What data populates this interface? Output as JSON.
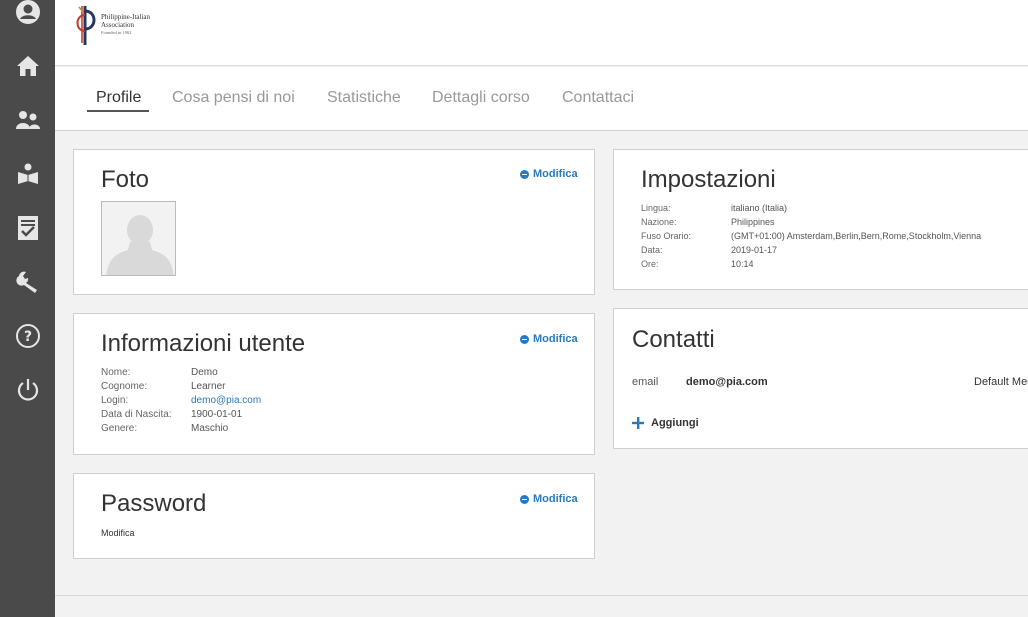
{
  "logo": {
    "line1": "Philippine-Italian",
    "line2": "Association",
    "line3": "Founded in 1962"
  },
  "sidebar": {
    "items": [
      {
        "name": "user-icon"
      },
      {
        "name": "home-icon"
      },
      {
        "name": "users-icon"
      },
      {
        "name": "reader-icon"
      },
      {
        "name": "checklist-icon"
      },
      {
        "name": "wrench-icon"
      },
      {
        "name": "help-icon"
      },
      {
        "name": "power-icon"
      }
    ]
  },
  "tabs": [
    {
      "label": "Profile",
      "active": true
    },
    {
      "label": "Cosa pensi di noi",
      "active": false
    },
    {
      "label": "Statistiche",
      "active": false
    },
    {
      "label": "Dettagli corso",
      "active": false
    },
    {
      "label": "Contattaci",
      "active": false
    }
  ],
  "foto": {
    "title": "Foto",
    "edit_label": "Modifica"
  },
  "info": {
    "title": "Informazioni utente",
    "edit_label": "Modifica",
    "rows": [
      {
        "label": "Nome:",
        "value": "Demo"
      },
      {
        "label": "Cognome:",
        "value": "Learner"
      },
      {
        "label": "Login:",
        "value": "demo@pia.com"
      },
      {
        "label": "Data di Nascita:",
        "value": "1900-01-01"
      },
      {
        "label": "Genere:",
        "value": "Maschio"
      }
    ]
  },
  "password": {
    "title": "Password",
    "edit_label": "Modifica",
    "text": "Modifica"
  },
  "settings": {
    "title": "Impostazioni",
    "rows": [
      {
        "label": "Lingua:",
        "value": "italiano (Italia)"
      },
      {
        "label": "Nazione:",
        "value": "Philippines"
      },
      {
        "label": "Fuso Orario:",
        "value": "(GMT+01:00) Amsterdam,Berlin,Bern,Rome,Stockholm,Vienna"
      },
      {
        "label": "Data:",
        "value": "2019-01-17"
      },
      {
        "label": "Ore:",
        "value": "10:14"
      }
    ]
  },
  "contacts": {
    "title": "Contatti",
    "type_label": "email",
    "email": "demo@pia.com",
    "default_label": "Default Med",
    "add_label": "Aggiungi"
  },
  "colors": {
    "accent": "#2a7ab8",
    "sidebar": "#4a4a4a"
  }
}
